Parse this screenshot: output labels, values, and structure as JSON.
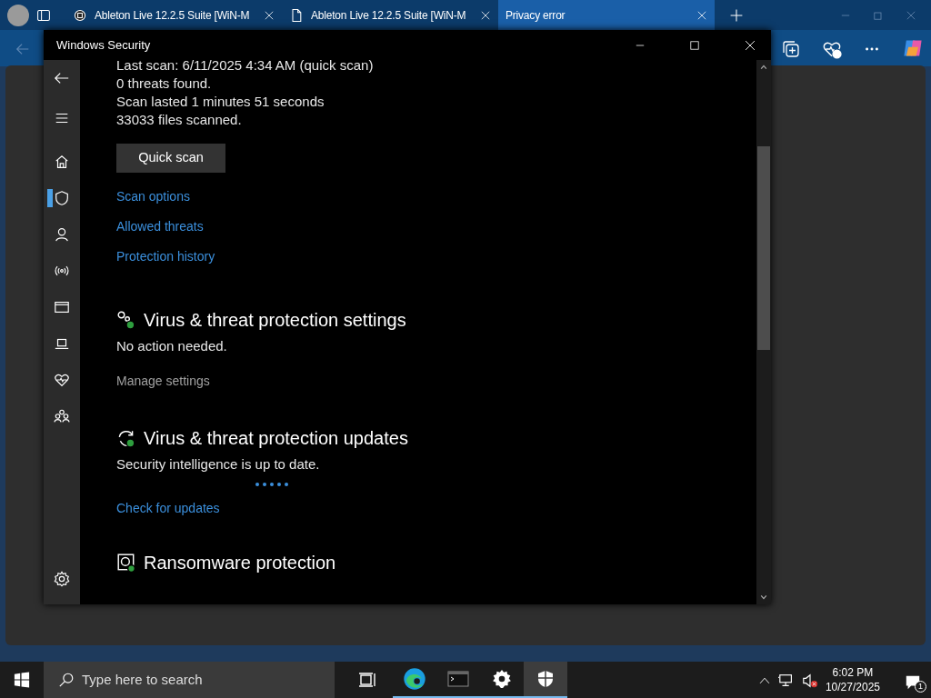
{
  "browser": {
    "tabs": [
      {
        "title": "Ableton Live 12.2.5 Suite [WiN-M",
        "kind": "site",
        "selected": false
      },
      {
        "title": "Ableton Live 12.2.5 Suite [WiN-M",
        "kind": "page",
        "selected": false
      },
      {
        "title": "Privacy error",
        "kind": "none",
        "selected": true
      }
    ]
  },
  "window": {
    "title": "Windows Security"
  },
  "sidebar": {
    "items": [
      {
        "kind": "home",
        "selected": false
      },
      {
        "kind": "shield",
        "selected": true
      },
      {
        "kind": "person",
        "selected": false
      },
      {
        "kind": "wireless",
        "selected": false
      },
      {
        "kind": "appbrowser",
        "selected": false
      },
      {
        "kind": "laptop",
        "selected": false
      },
      {
        "kind": "heart",
        "selected": false
      },
      {
        "kind": "family",
        "selected": false
      }
    ]
  },
  "scan_summary": [
    "Last scan: 6/11/2025 4:34 AM (quick scan)",
    "0 threats found.",
    "Scan lasted 1 minutes 51 seconds",
    "33033 files scanned."
  ],
  "quick_scan_button": "Quick scan",
  "scan_links": [
    "Scan options",
    "Allowed threats",
    "Protection history"
  ],
  "sections": [
    {
      "kind": "settings",
      "title": "Virus & threat protection settings",
      "status": "No action needed.",
      "busy": false,
      "link": {
        "label": "Manage settings",
        "disabled": true
      }
    },
    {
      "kind": "updates",
      "title": "Virus & threat protection updates",
      "status": "Security intelligence is up to date.",
      "busy": true,
      "link": {
        "label": "Check for updates",
        "disabled": false
      }
    },
    {
      "kind": "ransomware",
      "title": "Ransomware protection"
    }
  ],
  "taskbar": {
    "search_placeholder": "Type here to search",
    "apps": [
      {
        "kind": "taskview",
        "running": false,
        "selected": false
      },
      {
        "kind": "edge",
        "running": true,
        "selected": false
      },
      {
        "kind": "terminal",
        "running": true,
        "selected": false
      },
      {
        "kind": "settings",
        "running": true,
        "selected": false
      },
      {
        "kind": "security",
        "running": true,
        "selected": true
      }
    ],
    "time": "6:02 PM",
    "date": "10/27/2025",
    "notification_count": "1"
  }
}
